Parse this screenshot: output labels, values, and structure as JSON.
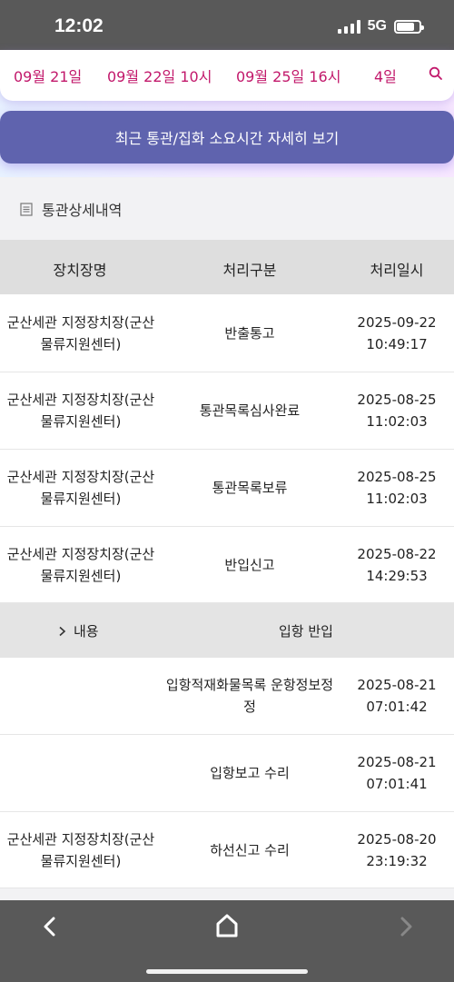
{
  "status_bar": {
    "time": "12:02",
    "network": "5G"
  },
  "date_strip": {
    "items": [
      "09월 21일",
      "09월 22일 10시",
      "09월 25일 16시",
      "4일"
    ]
  },
  "detail_button_label": "최근 통관/집화 소요시간 자세히 보기",
  "section_title": "통관상세내역",
  "table": {
    "headers": [
      "장치장명",
      "처리구분",
      "처리일시"
    ],
    "rows": [
      {
        "location": "군산세관 지정장치장(군산물류지원센터)",
        "type": "반출통고",
        "date": "2025-09-22",
        "time": "10:49:17"
      },
      {
        "location": "군산세관 지정장치장(군산물류지원센터)",
        "type": "통관목록심사완료",
        "date": "2025-08-25",
        "time": "11:02:03"
      },
      {
        "location": "군산세관 지정장치장(군산물류지원센터)",
        "type": "통관목록보류",
        "date": "2025-08-25",
        "time": "11:02:03"
      },
      {
        "location": "군산세관 지정장치장(군산물류지원센터)",
        "type": "반입신고",
        "date": "2025-08-22",
        "time": "14:29:53"
      }
    ],
    "group": {
      "toggle_label": "내용",
      "value": "입항 반입"
    },
    "rows_after": [
      {
        "location": "",
        "type": "입항적재화물목록 운항정보정정",
        "date": "2025-08-21",
        "time": "07:01:42"
      },
      {
        "location": "",
        "type": "입항보고 수리",
        "date": "2025-08-21",
        "time": "07:01:41"
      },
      {
        "location": "군산세관 지정장치장(군산물류지원센터)",
        "type": "하선신고 수리",
        "date": "2025-08-20",
        "time": "23:19:32"
      }
    ]
  },
  "colors": {
    "accent": "#c2186b",
    "button": "#5f63ae",
    "status_bar": "#595959"
  },
  "icons": {
    "search": "search-icon",
    "section": "document-icon",
    "group_toggle": "chevron-right-icon",
    "nav": [
      "back-icon",
      "home-icon",
      "forward-icon"
    ]
  }
}
